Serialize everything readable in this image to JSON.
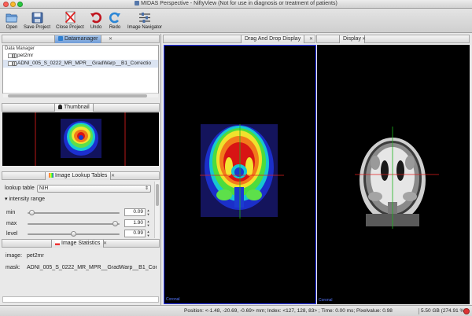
{
  "window": {
    "title": "MIDAS Perspective - NiftyView (Not for use in diagnosis or treatment of patients)"
  },
  "toolbar": {
    "open": "Open",
    "save_project": "Save Project",
    "close_project": "Close Project",
    "undo": "Undo",
    "redo": "Redo",
    "image_navigator": "Image Navigator"
  },
  "datamanager": {
    "tab": "Datamanager",
    "header": "Data Manager",
    "nodes": [
      "pet2mr",
      "ADNI_005_S_0222_MR_MPR__GradWarp__B1_Correctio"
    ]
  },
  "thumbnail": {
    "tab": "Thumbnail"
  },
  "lookup": {
    "tab": "Image Lookup Tables",
    "lookup_table_label": "lookup table",
    "lookup_table_value": "NIH",
    "intensity_range_label": "intensity range",
    "min_label": "min",
    "min_value": "0.09",
    "max_label": "max",
    "max_value": "1.90",
    "level_label": "level",
    "level_value": "0.99",
    "sliders": {
      "min": 0.09,
      "max": 1.9,
      "level": 0.99
    }
  },
  "stats": {
    "tab": "Image Statistics",
    "image_label": "image:",
    "image_value": "pet2mr",
    "mask_label": "mask:",
    "mask_value": "ADNI_005_S_0222_MR_MPR__GradWarp__B1_Correctio"
  },
  "views": {
    "drag_drop_title": "Drag And Drop Display",
    "display_title": "Display",
    "orientation_label": "Coronal"
  },
  "status": {
    "position_text": "Position: <-1.48, -20.69, -0.69> mm; Index: <127, 128, 83> ; Time: 0.00 ms; Pixelvalue: 0.98",
    "memory_text": "5.50 GB (274.91 %)"
  },
  "colors": {
    "accent_selected_tab": "#6f9bd6",
    "display_border": "#2b38ff",
    "crosshair_red": "#e11e1e",
    "crosshair_green": "#1fb51f",
    "undo_icon": "#c0141e",
    "redo_icon": "#2a86d6"
  },
  "icons": {
    "open": "open-folder-icon",
    "save_project": "save-floppy-icon",
    "close_project": "close-project-icon",
    "undo": "undo-arrow-icon",
    "redo": "redo-arrow-icon",
    "image_navigator": "sliders-icon",
    "memory": "memory-status-icon"
  }
}
